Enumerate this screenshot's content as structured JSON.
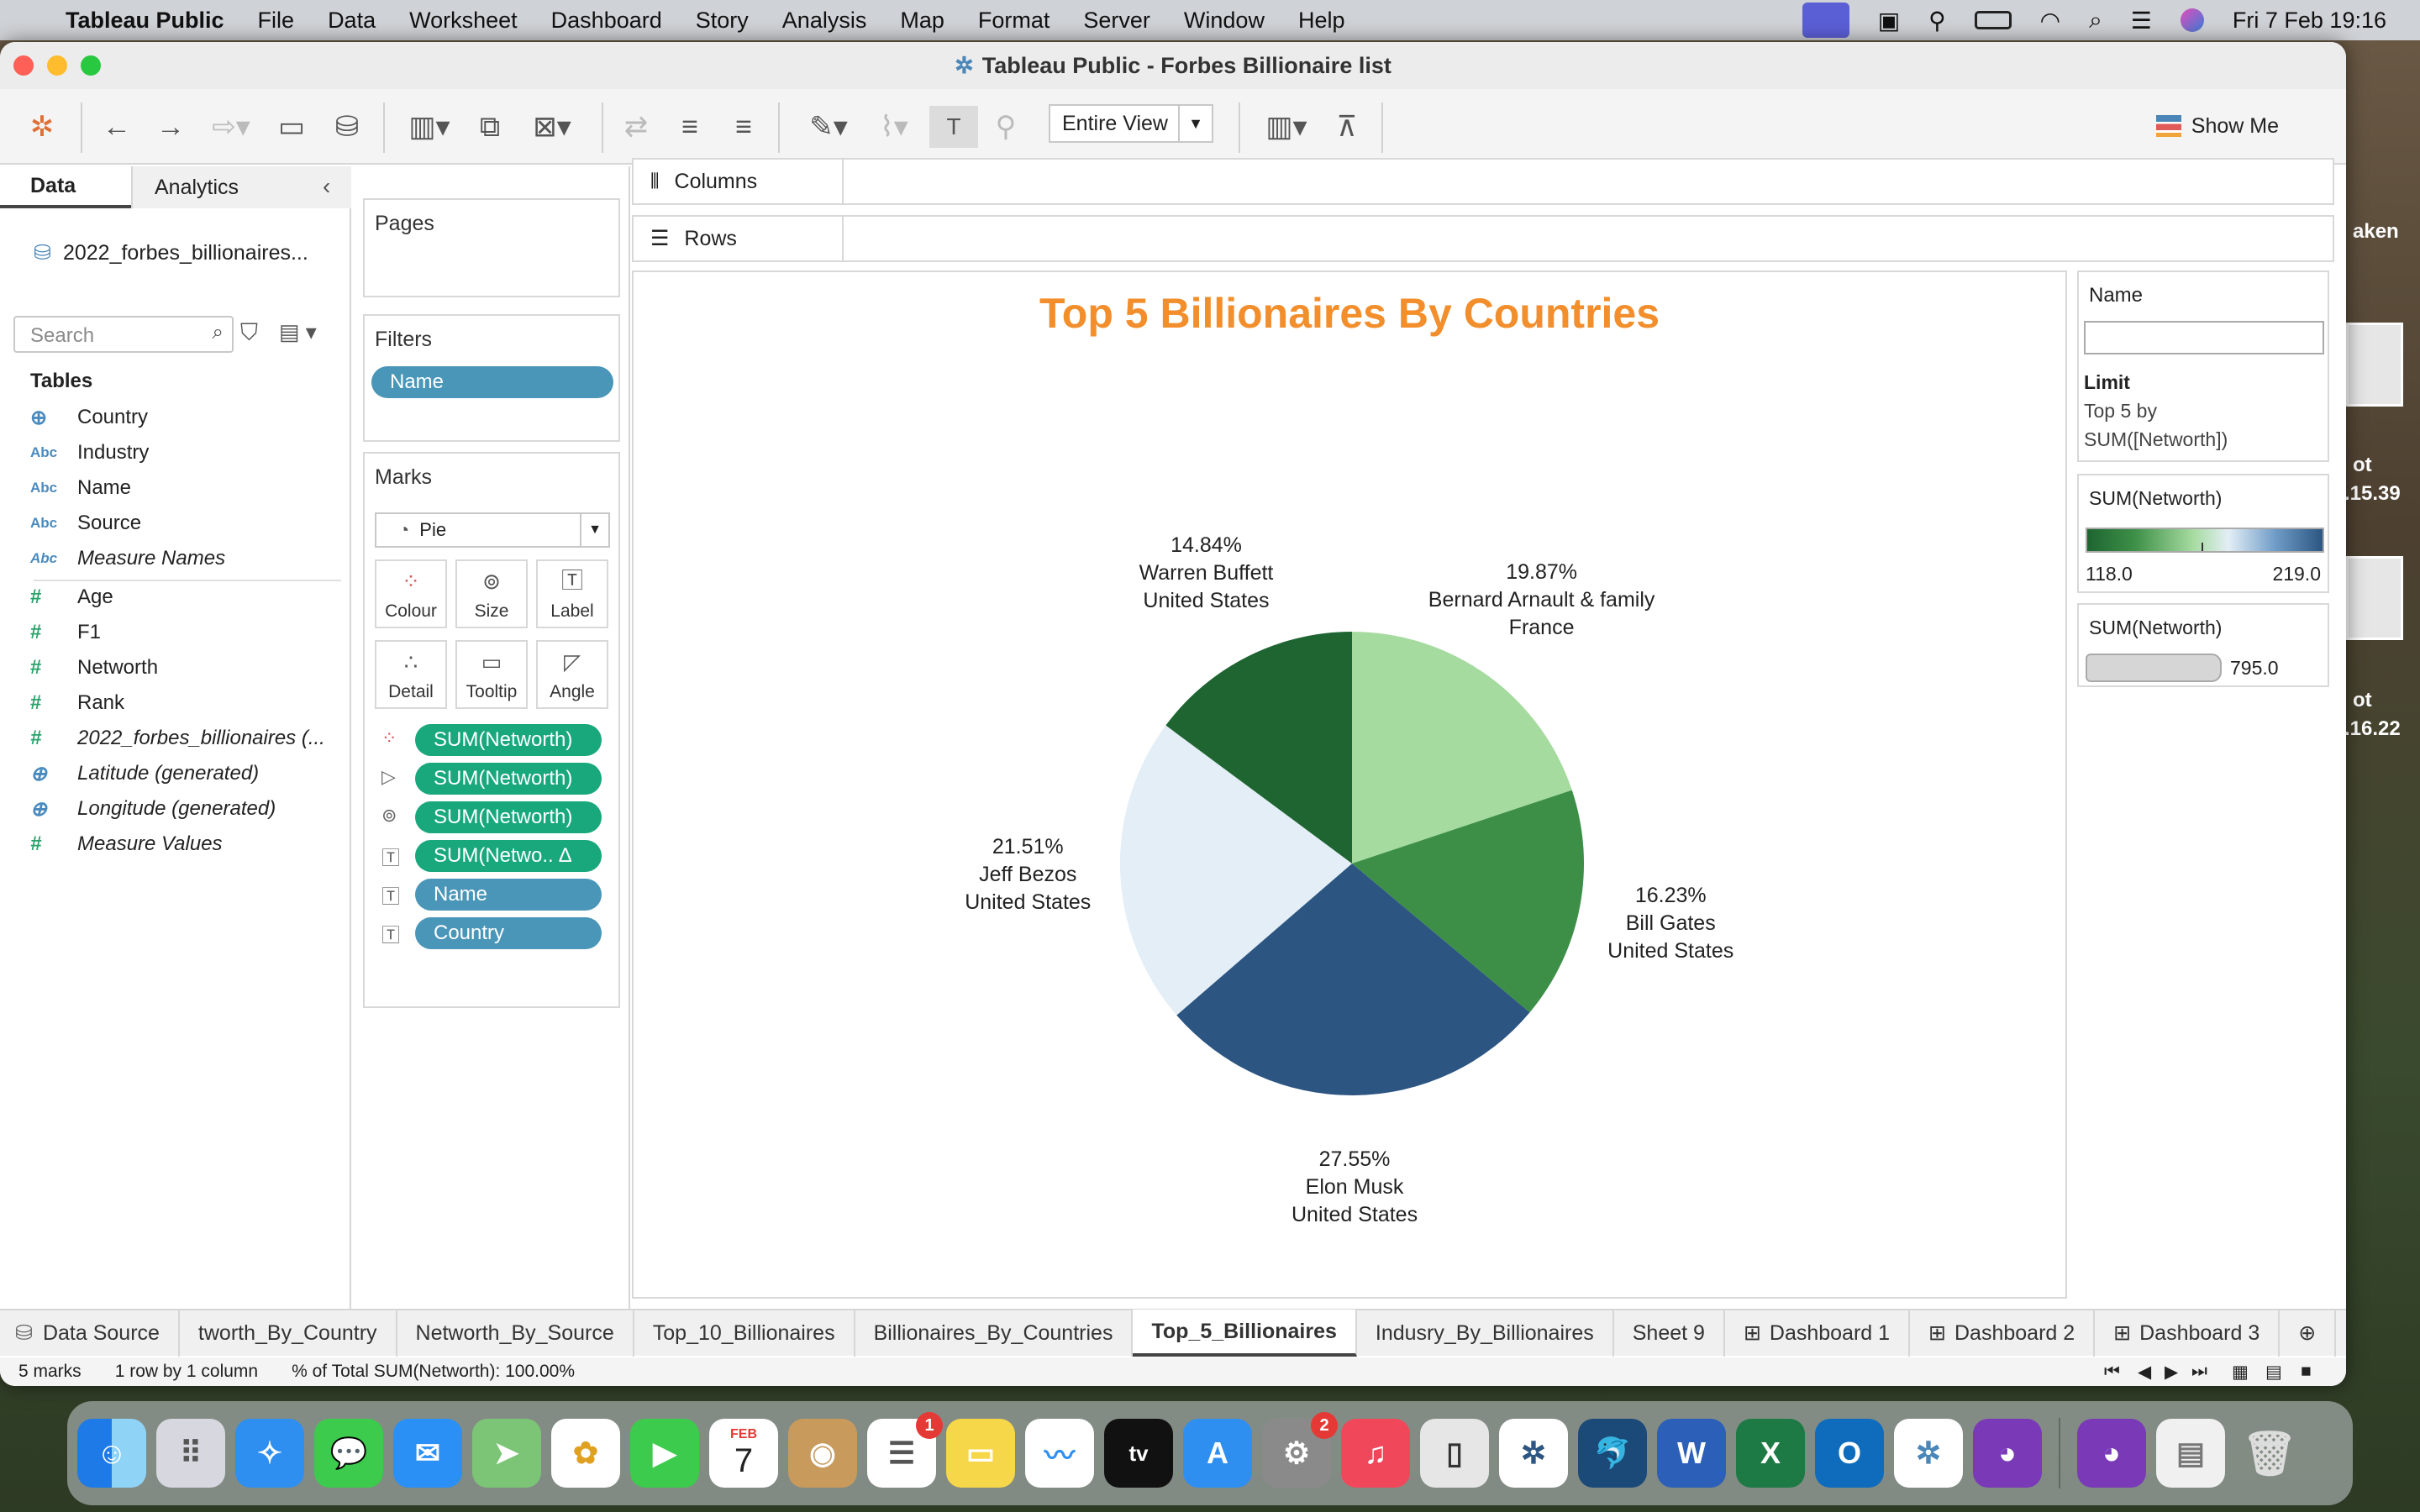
{
  "menubar": {
    "app_name": "Tableau Public",
    "items": [
      "File",
      "Data",
      "Worksheet",
      "Dashboard",
      "Story",
      "Analysis",
      "Map",
      "Format",
      "Server",
      "Window",
      "Help"
    ],
    "clock": "Fri 7 Feb  19:16"
  },
  "window": {
    "title": "Tableau Public - Forbes Billionaire list"
  },
  "toolbar": {
    "view_mode": "Entire View",
    "show_me": "Show Me"
  },
  "data_pane": {
    "tab_data": "Data",
    "tab_analytics": "Analytics",
    "datasource": "2022_forbes_billionaires...",
    "search_placeholder": "Search",
    "tables_heading": "Tables",
    "fields": [
      {
        "name": "Country",
        "type": "geo"
      },
      {
        "name": "Industry",
        "type": "Abc"
      },
      {
        "name": "Name",
        "type": "Abc"
      },
      {
        "name": "Source",
        "type": "Abc"
      },
      {
        "name": "Measure Names",
        "type": "Abc"
      },
      {
        "name": "Age",
        "type": "#"
      },
      {
        "name": "F1",
        "type": "#"
      },
      {
        "name": "Networth",
        "type": "#"
      },
      {
        "name": "Rank",
        "type": "#"
      },
      {
        "name": "2022_forbes_billionaires (...",
        "type": "#"
      },
      {
        "name": "Latitude (generated)",
        "type": "geo"
      },
      {
        "name": "Longitude (generated)",
        "type": "geo"
      },
      {
        "name": "Measure Values",
        "type": "#"
      }
    ]
  },
  "shelves": {
    "pages": "Pages",
    "filters": "Filters",
    "filter_pill": "Name",
    "marks": "Marks",
    "mark_type": "Pie",
    "mark_buttons": [
      "Colour",
      "Size",
      "Label",
      "Detail",
      "Tooltip",
      "Angle"
    ],
    "mark_pills": [
      "SUM(Networth)",
      "SUM(Networth)",
      "SUM(Networth)",
      "SUM(Netwo.. ∆",
      "Name",
      "Country"
    ],
    "columns": "Columns",
    "rows": "Rows"
  },
  "chart_data": {
    "type": "pie",
    "title": "Top 5 Billionaires By Countries",
    "slices": [
      {
        "name": "Bernard Arnault & family",
        "country": "France",
        "percent": 19.87,
        "pct_label": "19.87%",
        "color": "#a6dba0"
      },
      {
        "name": "Bill Gates",
        "country": "United States",
        "percent": 16.23,
        "pct_label": "16.23%",
        "color": "#3d8f47"
      },
      {
        "name": "Elon Musk",
        "country": "United States",
        "percent": 27.55,
        "pct_label": "27.55%",
        "color": "#2c5582"
      },
      {
        "name": "Jeff Bezos",
        "country": "United States",
        "percent": 21.51,
        "pct_label": "21.51%",
        "color": "#e3eef6"
      },
      {
        "name": "Warren Buffett",
        "country": "United States",
        "percent": 14.84,
        "pct_label": "14.84%",
        "color": "#1e6531"
      }
    ]
  },
  "legend": {
    "name_heading": "Name",
    "limit_heading": "Limit",
    "limit_text_1": "Top 5 by",
    "limit_text_2": "SUM([Networth])",
    "color_heading": "SUM(Networth)",
    "color_min": "118.0",
    "color_max": "219.0",
    "size_heading": "SUM(Networth)",
    "size_value": "795.0"
  },
  "sheet_tabs": [
    "Data Source",
    "tworth_By_Country",
    "Networth_By_Source",
    "Top_10_Billionaires",
    "Billionaires_By_Countries",
    "Top_5_Billionaires",
    "Indusry_By_Billionaires",
    "Sheet 9",
    "Dashboard 1",
    "Dashboard 2",
    "Dashboard 3"
  ],
  "active_tab": "Top_5_Billionaires",
  "status": {
    "marks": "5 marks",
    "dims": "1 row  by  1 column",
    "total": "% of Total SUM(Networth): 100.00%"
  },
  "dock": {
    "calendar_month": "FEB",
    "calendar_day": "7",
    "reminders_badge": "1",
    "settings_badge": "2"
  },
  "desktop_labels": [
    "aken",
    "ot",
    ".15.39",
    "ot",
    ".16.22"
  ]
}
